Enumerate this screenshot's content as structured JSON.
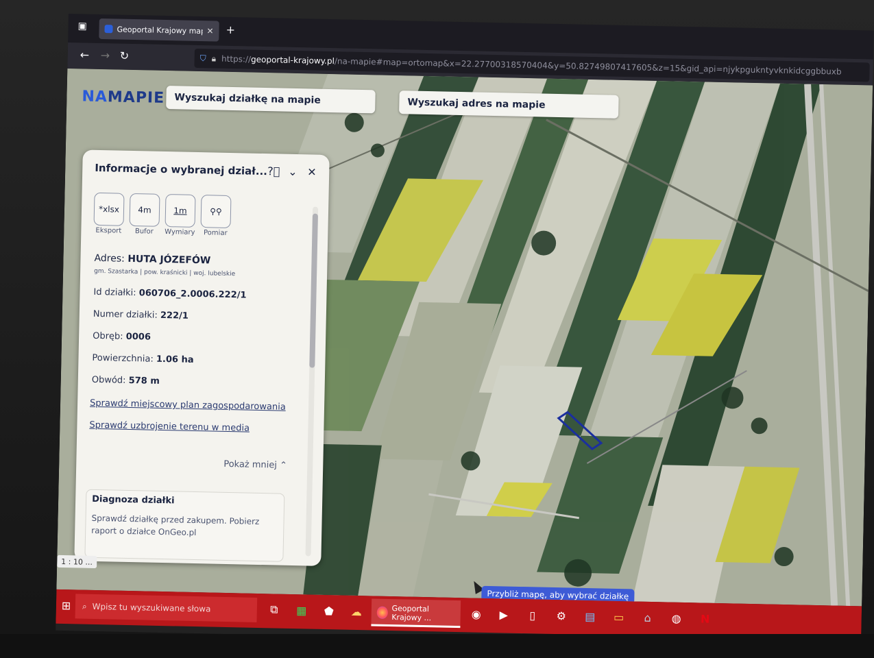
{
  "browser": {
    "tab_title": "Geoportal Krajowy mapy i infor",
    "url_protocol": "https://",
    "url_host": "geoportal-krajowy.pl",
    "url_rest": "/na-mapie#map=ortomap&x=22.27700318570404&y=50.82749807417605&z=15&gid_api=njykpgukntyvknkidcggbbuxb"
  },
  "map": {
    "logo_na": "NA",
    "logo_mapie": "MAPIE",
    "search_parcel": "Wyszukaj działkę na mapie",
    "search_address": "Wyszukaj adres na mapie",
    "scale": "1 : 10 ...",
    "hint": "Przybliż mapę, aby wybrać działkę"
  },
  "panel": {
    "title": "Informacje o wybranej dział...",
    "tools": [
      {
        "icon": "xlsx",
        "label": "Eksport"
      },
      {
        "icon": "4m",
        "label": "Bufor"
      },
      {
        "icon": "1m",
        "label": "Wymiary"
      },
      {
        "icon": "pin-pair",
        "label": "Pomiar"
      }
    ],
    "address_label": "Adres:",
    "address_value": "HUTA JÓZEFÓW",
    "admin": "gm. Szastarka | pow. kraśnicki | woj. lubelskie",
    "id_label": "Id działki:",
    "id_value": "060706_2.0006.222/1",
    "number_label": "Numer działki:",
    "number_value": "222/1",
    "obreb_label": "Obręb:",
    "obreb_value": "0006",
    "area_label": "Powierzchnia:",
    "area_value": "1.06 ha",
    "perimeter_label": "Obwód:",
    "perimeter_value": "578 m",
    "link_plan": "Sprawdź miejscowy plan zagospodarowania",
    "link_media": "Sprawdź uzbrojenie terenu w media",
    "show_less": "Pokaż mniej",
    "diag_title": "Diagnoza działki",
    "diag_text": "Sprawdź działkę przed zakupem. Pobierz raport o działce OnGeo.pl"
  },
  "taskbar": {
    "search_placeholder": "Wpisz tu wyszukiwane słowa",
    "firefox_label": "Geoportal Krajowy ..."
  },
  "colors": {
    "taskbar": "#b8171a",
    "accent": "#3d5bd6",
    "panel_bg": "#f4f3ee"
  }
}
